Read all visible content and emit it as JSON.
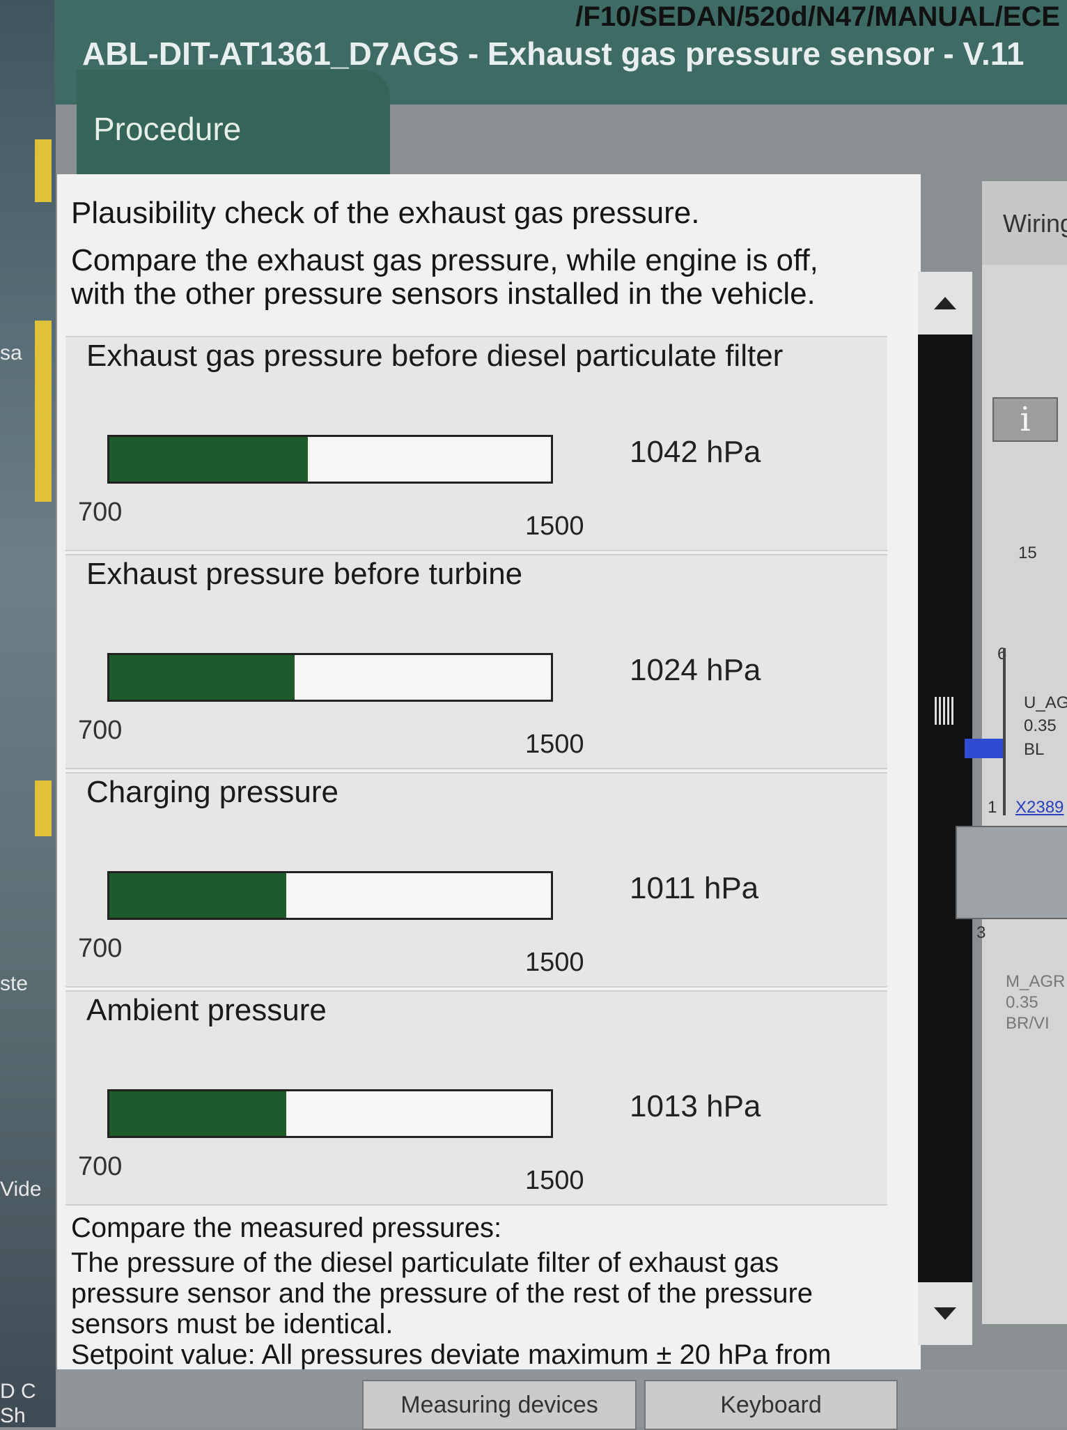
{
  "titlebar": {
    "path": "/F10/SEDAN/520d/N47/MANUAL/ECE",
    "title": "ABL-DIT-AT1361_D7AGS - Exhaust gas pressure sensor - V.11"
  },
  "tab": {
    "label": "Procedure"
  },
  "desktop": {
    "labels": [
      "sa",
      "ste",
      "Vide",
      "D C",
      "Sh"
    ]
  },
  "intro": {
    "line1": "Plausibility check of the exhaust gas pressure.",
    "line2": "Compare the exhaust gas pressure, while engine is off, with the other pressure sensors installed in the vehicle."
  },
  "gauges": [
    {
      "title": "Exhaust gas pressure before diesel particulate filter",
      "min": "700",
      "max": "1500",
      "value": "1042 hPa",
      "fraction": 0.45
    },
    {
      "title": "Exhaust pressure before turbine",
      "min": "700",
      "max": "1500",
      "value": "1024 hPa",
      "fraction": 0.42
    },
    {
      "title": "Charging pressure",
      "min": "700",
      "max": "1500",
      "value": "1011 hPa",
      "fraction": 0.4
    },
    {
      "title": "Ambient pressure",
      "min": "700",
      "max": "1500",
      "value": "1013 hPa",
      "fraction": 0.4
    }
  ],
  "compare": {
    "heading": "Compare the measured pressures:",
    "body": "The pressure of the diesel particulate filter of exhaust gas pressure sensor and the pressure of the rest of the pressure sensors must be identical.",
    "setpoint": "Setpoint value: All pressures deviate maximum ± 20 hPa from"
  },
  "rightpanel": {
    "wiring": "Wiring",
    "info": "i",
    "pin15": "15",
    "pin6": "6",
    "wire_name": "U_AG",
    "wire_size": "0.35",
    "wire_color": "BL",
    "pin1": "1",
    "connector": "X2389",
    "pin3": "3",
    "wire2_name": "M_AGR",
    "wire2_size": "0.35",
    "wire2_color": "BR/VI"
  },
  "buttons": {
    "measuring": "Measuring devices",
    "keyboard": "Keyboard"
  },
  "colors": {
    "titlebar": "#3e6b63",
    "gauge_fill": "#1f5a2a",
    "panel": "#f1f1f1"
  }
}
